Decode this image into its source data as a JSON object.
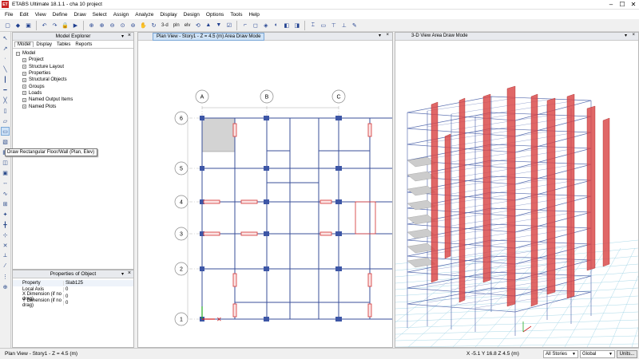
{
  "app": {
    "title": "ETABS Ultimate 18.1.1 - cha 10 project",
    "icon_text": "ET"
  },
  "window_controls": [
    "–",
    "☐",
    "✕"
  ],
  "menu": [
    "File",
    "Edit",
    "View",
    "Define",
    "Draw",
    "Select",
    "Assign",
    "Analyze",
    "Display",
    "Design",
    "Options",
    "Tools",
    "Help"
  ],
  "toolbar": {
    "view_3d_label": "3-d",
    "view_pln_label": "pln",
    "view_elv_label": "elv",
    "icons": [
      "new-icon",
      "open-icon",
      "save-icon",
      "undo-icon",
      "redo-icon",
      "lock-icon",
      "run-icon",
      "zoom-pan-icon",
      "zoom-in-icon",
      "zoom-out-icon",
      "zoom-window-icon",
      "zoom-all-icon",
      "pan-icon",
      "refresh-icon",
      "move-up-icon",
      "move-down-icon",
      "pointer-icon",
      "rubber-band-icon",
      "select-icon",
      "display-options-icon",
      "frame-icon",
      "shell-icon",
      "brace-icon",
      "text-icon"
    ]
  },
  "left_tools": [
    "pointer",
    "reshape",
    "joint",
    "frame",
    "brace",
    "column",
    "beam",
    "wall",
    "floor",
    "rect-floor",
    "area-void",
    "slab",
    "grid",
    "dimension",
    "section-cut",
    "snap",
    "tendon",
    "link",
    "quick",
    "mid",
    "end",
    "snap-grid"
  ],
  "explorer": {
    "title": "Model Explorer",
    "tabs": [
      "Model",
      "Display",
      "Tables",
      "Reports"
    ],
    "tree_root": "Model",
    "tree_items": [
      "Project",
      "Structure Layout",
      "Properties",
      "Structural Objects",
      "Groups",
      "Loads",
      "Named Output Items",
      "Named Plots"
    ]
  },
  "tooltip": "Draw Rectangular Floor/Wall (Plan, Elev)",
  "properties": {
    "title": "Properties of Object",
    "rows": [
      {
        "k": "Property",
        "v": "Slab125"
      },
      {
        "k": "Local Axis",
        "v": "0"
      },
      {
        "k": "X Dimension (if no drag)",
        "v": "0"
      },
      {
        "k": "Y Dimension (if no drag)",
        "v": "0"
      }
    ]
  },
  "plan_view": {
    "tab": "Plan View - Story1 - Z = 4.5 (m)  Area Draw Mode",
    "col_bubbles": [
      "A",
      "B",
      "C"
    ],
    "row_bubbles": [
      "6",
      "5",
      "4",
      "3",
      "2",
      "1"
    ]
  },
  "view_3d": {
    "tab": "3-D View  Area Draw Mode"
  },
  "status": {
    "left": "Plan View - Story1 - Z = 4.5 (m)",
    "coords": "X -5.1  Y 16.8  Z 4.5 (m)",
    "stories": "All Stories",
    "coord_sys": "Global",
    "units": "Units..."
  },
  "colors": {
    "grid_line": "#3a4f9a",
    "column": "#3d56a6",
    "wall": "#d84545",
    "selected": "#cfe3f7"
  }
}
